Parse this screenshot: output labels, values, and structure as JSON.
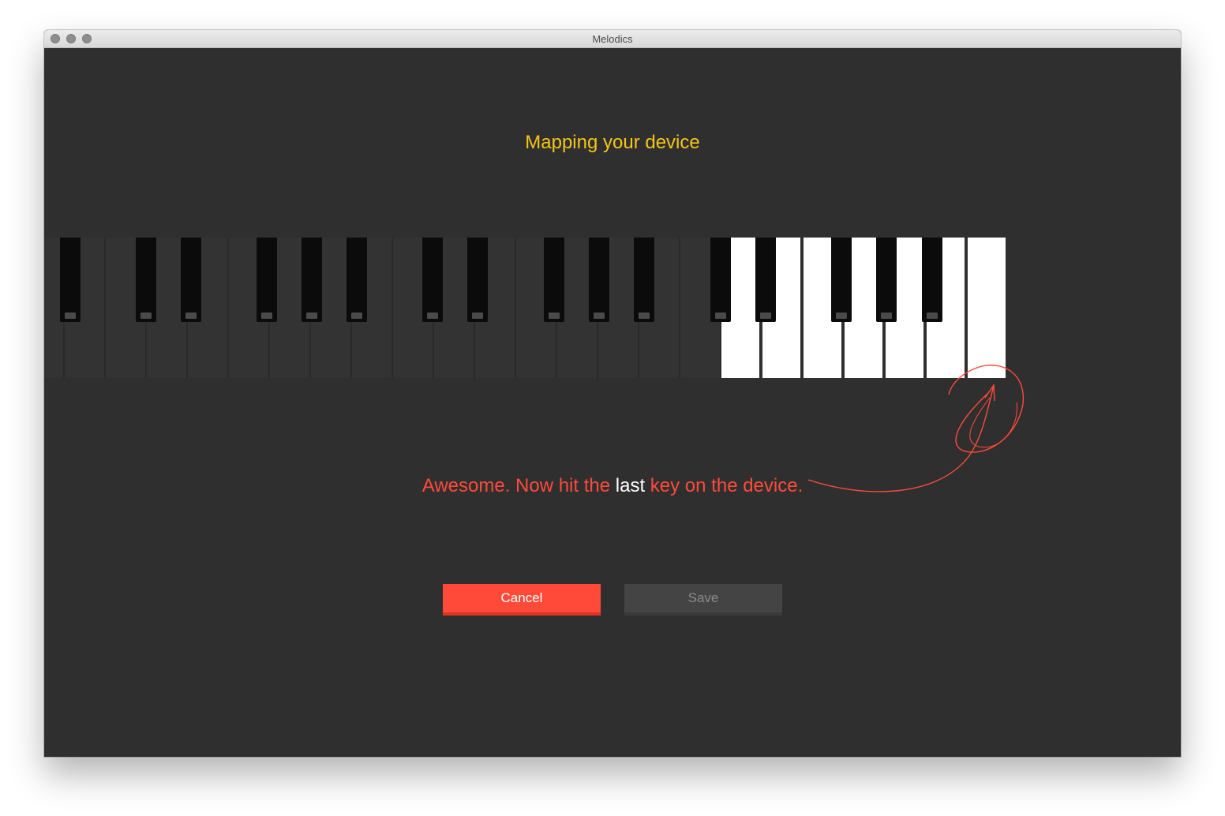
{
  "window": {
    "title": "Melodics"
  },
  "page": {
    "heading": "Mapping your device",
    "instruction": {
      "before": "Awesome. Now hit the ",
      "emphasis": "last",
      "after": " key on the device."
    }
  },
  "buttons": {
    "cancel_label": "Cancel",
    "save_label": "Save"
  },
  "keyboard": {
    "white_key_count": 24,
    "mapped_white_keys_from_right": 7,
    "black_key_count": 17,
    "colors": {
      "unmapped_white": "#333333",
      "mapped_white": "#ffffff",
      "black": "#0b0b0b"
    }
  },
  "colors": {
    "background": "#2f2f2f",
    "heading": "#f5c518",
    "accent": "#ff4a3a",
    "save_disabled": "#444444"
  }
}
